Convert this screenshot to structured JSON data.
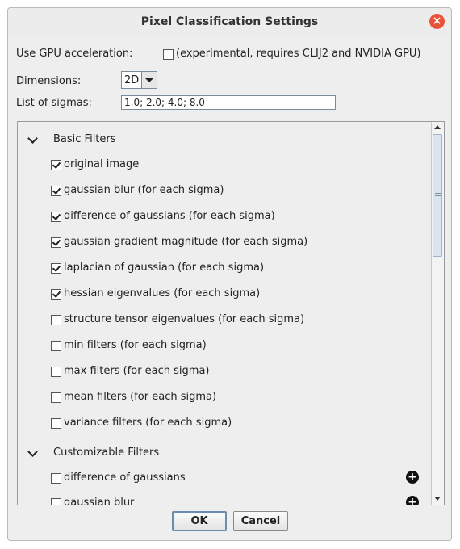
{
  "window": {
    "title": "Pixel Classification Settings"
  },
  "gpu": {
    "label": "Use GPU acceleration:",
    "checkbox_label": "(experimental, requires CLIJ2 and NVIDIA GPU)",
    "checked": false
  },
  "dimensions": {
    "label": "Dimensions:",
    "value": "2D"
  },
  "sigmas": {
    "label": "List of sigmas:",
    "value": "1.0; 2.0; 4.0; 8.0"
  },
  "basic_filters": {
    "title": "Basic Filters",
    "items": [
      {
        "label": "original image",
        "checked": true
      },
      {
        "label": "gaussian blur (for each sigma)",
        "checked": true
      },
      {
        "label": "difference of gaussians (for each sigma)",
        "checked": true
      },
      {
        "label": "gaussian gradient magnitude (for each sigma)",
        "checked": true
      },
      {
        "label": "laplacian of gaussian (for each sigma)",
        "checked": true
      },
      {
        "label": "hessian eigenvalues (for each sigma)",
        "checked": true
      },
      {
        "label": "structure tensor eigenvalues (for each sigma)",
        "checked": false
      },
      {
        "label": "min filters (for each sigma)",
        "checked": false
      },
      {
        "label": "max filters (for each sigma)",
        "checked": false
      },
      {
        "label": "mean filters (for each sigma)",
        "checked": false
      },
      {
        "label": "variance filters (for each sigma)",
        "checked": false
      }
    ]
  },
  "custom_filters": {
    "title": "Customizable Filters",
    "items": [
      {
        "label": "difference of gaussians",
        "checked": false
      },
      {
        "label": "gaussian blur",
        "checked": false
      }
    ]
  },
  "buttons": {
    "ok": "OK",
    "cancel": "Cancel"
  }
}
